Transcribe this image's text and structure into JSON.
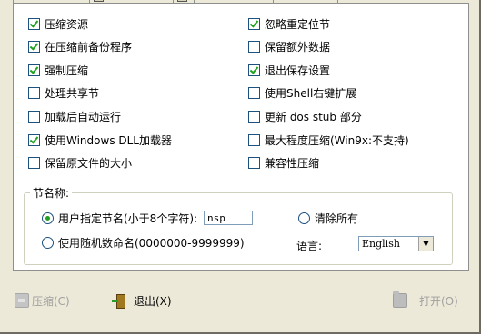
{
  "options_left": [
    {
      "label": "压缩资源",
      "checked": true
    },
    {
      "label": "在压缩前备份程序",
      "checked": true
    },
    {
      "label": "强制压缩",
      "checked": true
    },
    {
      "label": "处理共享节",
      "checked": false
    },
    {
      "label": "加载后自动运行",
      "checked": false
    },
    {
      "label": "使用Windows DLL加载器",
      "checked": true
    },
    {
      "label": "保留原文件的大小",
      "checked": false
    }
  ],
  "options_right": [
    {
      "label": "忽略重定位节",
      "checked": true
    },
    {
      "label": "保留额外数据",
      "checked": false
    },
    {
      "label": "退出保存设置",
      "checked": true
    },
    {
      "label": "使用Shell右键扩展",
      "checked": false
    },
    {
      "label": "更新 dos stub 部分",
      "checked": false
    },
    {
      "label": "最大程度压缩(Win9x:不支持)",
      "checked": false
    },
    {
      "label": "兼容性压缩",
      "checked": false
    }
  ],
  "section_group": {
    "title": "节名称:",
    "user_name_label": "用户指定节名(小于8个字符):",
    "user_name_value": "nsp",
    "random_name_label": "使用随机数命名(0000000-9999999)",
    "clear_all_label": "清除所有",
    "selected": "user"
  },
  "language": {
    "label": "语言:",
    "value": "English"
  },
  "buttons": {
    "compress": "压缩(C)",
    "exit": "退出(X)",
    "open": "打开(O)"
  }
}
